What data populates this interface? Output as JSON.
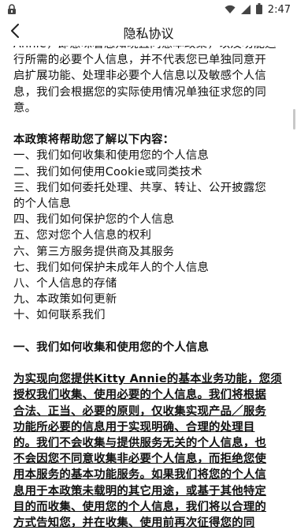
{
  "status_bar": {
    "time": "2:47"
  },
  "app_bar": {
    "title": "隐私协议",
    "back_icon": "back-arrow-icon"
  },
  "content": {
    "intro_lines": [
      "Annie，即意味着您知晓且同意本政策，以及功能运",
      "行所需的必要个人信息，并不代表您已单独同意开",
      "启扩展功能、处理非必要个人信息以及敏感个人信",
      "息，我们会根据您的实际使用情况单独征求您的同",
      "意。"
    ],
    "toc_heading": "本政策将帮助您了解以下内容：",
    "toc_items": [
      "一、我们如何收集和使用您的个人信息",
      "二、我们如何使用Cookie或同类技术",
      "三、我们如何委托处理、共享、转让、公开披露您",
      "的个人信息",
      "四、我们如何保护您的个人信息",
      "五、您对您个人信息的权利",
      "六、第三方服务提供商及其服务",
      "七、我们如何保护未成年人的个人信息",
      "八、个人信息的存储",
      "九、本政策如何更新",
      "十、如何联系我们"
    ],
    "section_heading": "一、我们如何收集和使用您的个人信息",
    "section_lines": [
      "为实现向您提供Kitty Annie的基本业务功能，您须",
      "授权我们收集、使用必要的个人信息。我们将根据",
      "合法、正当、必要的原则，仅收集实现产品／服务",
      "功能所必要的信息用于实现明确、合理的处理目",
      "的。我们不会收集与提供服务无关的个人信息，也",
      "不会因您不同意收集非必要个人信息，而拒绝您使",
      "用本服务的基本功能服务。如果我们将您的个人信",
      "息用于本政策未载明的其它用途，或基于其他特定",
      "目的而收集、使用您的个人信息，我们将以合理的",
      "方式告知您，并在收集、使用前再次征得您的同"
    ]
  }
}
